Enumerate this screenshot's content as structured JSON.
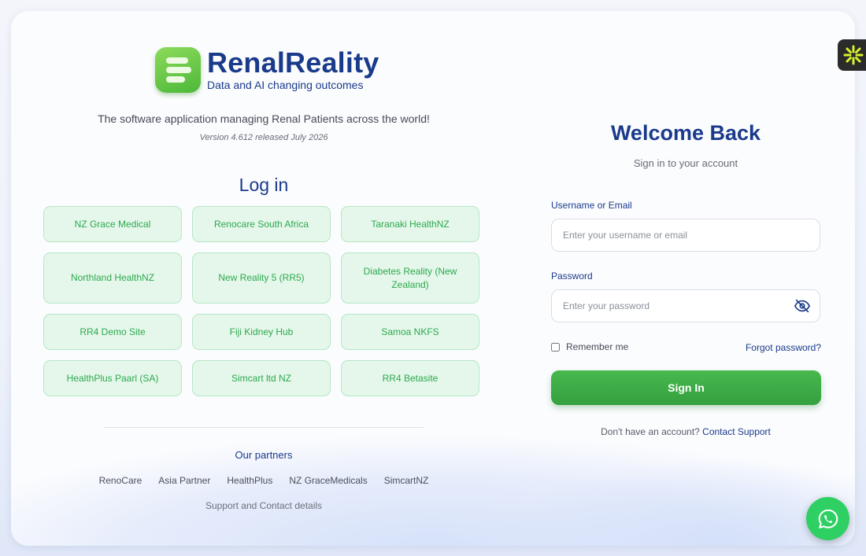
{
  "brand": {
    "name": "RenalReality",
    "tagline": "Data and AI changing outcomes",
    "description": "The software application managing Renal Patients across the world!",
    "version": "Version 4.612 released July 2026",
    "colors": {
      "primary": "#1a3a8a",
      "accent_green": "#3aa845",
      "site_text": "#2ea84f"
    }
  },
  "login": {
    "title": "Log in",
    "sites": [
      "NZ Grace Medical",
      "Renocare South Africa",
      "Taranaki HealthNZ",
      "Northland HealthNZ",
      "New Reality 5 (RR5)",
      "Diabetes Reality (New Zealand)",
      "RR4 Demo Site",
      "Fiji Kidney Hub",
      "Samoa NKFS",
      "HealthPlus Paarl (SA)",
      "Simcart ltd NZ",
      "RR4 Betasite"
    ]
  },
  "partners": {
    "title": "Our partners",
    "items": [
      "RenoCare",
      "Asia Partner",
      "HealthPlus",
      "NZ GraceMedicals",
      "SimcartNZ"
    ],
    "support_link": "Support and Contact details"
  },
  "signin": {
    "title": "Welcome Back",
    "subtitle": "Sign in to your account",
    "username_label": "Username or Email",
    "username_placeholder": "Enter your username or email",
    "password_label": "Password",
    "password_placeholder": "Enter your password",
    "remember_label": "Remember me",
    "forgot_label": "Forgot password?",
    "button_label": "Sign In",
    "no_account_text": "Don't have an account?",
    "contact_label": "Contact Support"
  },
  "icons": {
    "password_toggle": "eye-slash-icon",
    "extension": "sparkle-icon",
    "chat": "whatsapp-icon"
  }
}
